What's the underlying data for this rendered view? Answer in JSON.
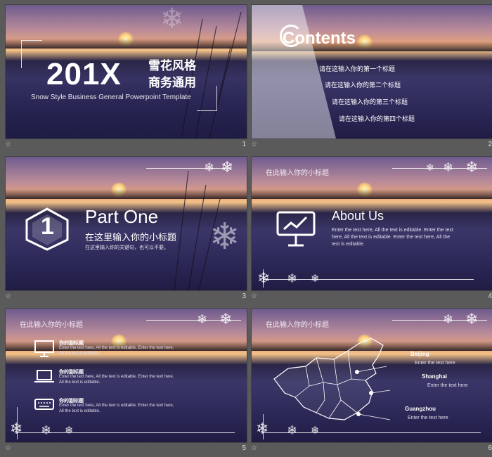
{
  "slides": [
    {
      "title_big": "201X",
      "title_cn_1": "雪花风格",
      "title_cn_2": "商务通用",
      "subtitle": "Snow Style Business General Powerpoint Template",
      "number": "1"
    },
    {
      "contents_title": "Contents",
      "items": [
        "请在这输入你的第一个标题",
        "请在这输入你的第二个标题",
        "请在这输入你的第三个标题",
        "请在这输入你的第四个标题"
      ],
      "number": "2"
    },
    {
      "badge": "1",
      "part_title": "Part One",
      "part_sub": "在这里输入你的小标题",
      "part_keywords": "在这里输入你的关键句，也可以不要。",
      "number": "3"
    },
    {
      "section_title": "在此输入你的小标题",
      "about_title": "About Us",
      "about_body": "Enter the text here, All the text is editable. Enter the text here, All the text is editable. Enter the text here, All the text is editable.",
      "number": "4"
    },
    {
      "section_title": "在此输入你的小标题",
      "rows": [
        {
          "heading": "你的副标题",
          "line1": "Enter the text here, All the text is editable. Enter the text here,",
          "line2": "All the text is editable."
        },
        {
          "heading": "你的副标题",
          "line1": "Enter the text here, All the text is editable. Enter the text here,",
          "line2": "All the text is editable."
        },
        {
          "heading": "你的副标题",
          "line1": "Enter the text here, All the text is editable. Enter the text here,",
          "line2": "All the text is editable."
        }
      ],
      "number": "5"
    },
    {
      "section_title": "在此输入你的小标题",
      "cities": [
        {
          "name": "Beijing",
          "note": "Enter the text here"
        },
        {
          "name": "Shanghai",
          "note": "Enter the text here"
        },
        {
          "name": "Guangzhou",
          "note": "Enter the text here"
        }
      ],
      "number": "6"
    }
  ],
  "footer_icon": "star-icon",
  "icons": [
    "snowflake-icon",
    "presentation-chart-icon",
    "monitor-icon",
    "laptop-icon",
    "keyboard-icon",
    "china-map-icon"
  ]
}
